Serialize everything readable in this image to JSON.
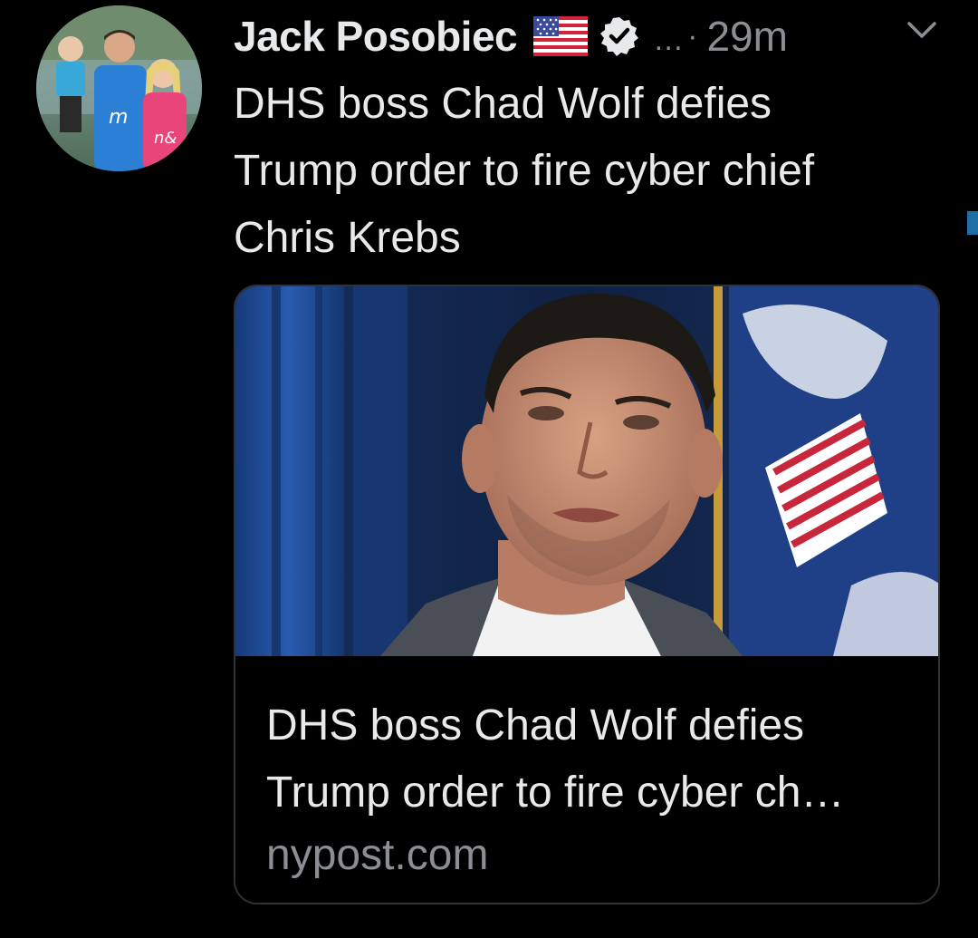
{
  "tweet": {
    "author": {
      "display_name": "Jack Posobiec",
      "flag_icon": "us-flag-emoji",
      "verified_icon": "verified-badge-icon",
      "avatar_icon": "profile-avatar"
    },
    "more_ellipsis": "…",
    "separator": "·",
    "timestamp": "29m",
    "menu_icon": "chevron-down-icon",
    "text_lines": [
      "DHS boss Chad Wolf defies",
      "Trump order to fire cyber chief",
      "Chris Krebs"
    ],
    "link_card": {
      "image_icon": "article-photo",
      "title_lines": [
        "DHS boss Chad Wolf defies",
        "Trump order to fire cyber ch…"
      ],
      "domain": "nypost.com"
    }
  },
  "colors": {
    "background": "#000000",
    "text_primary": "#e7e9ea",
    "text_secondary": "#8b8f93",
    "card_border": "#2f3336",
    "accent": "#1d6fa5"
  }
}
